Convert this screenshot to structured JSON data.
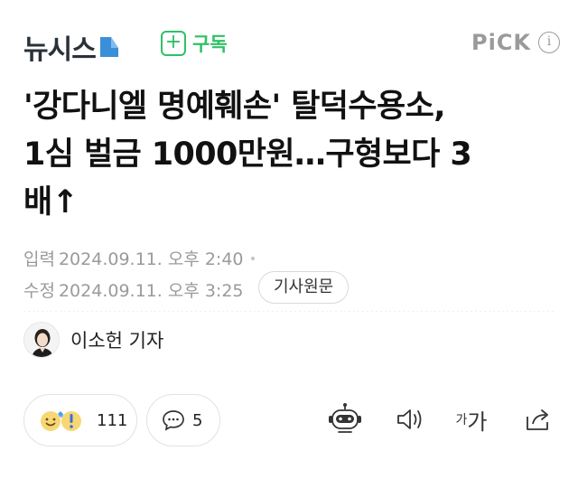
{
  "header": {
    "logo_text": "뉴시스",
    "subscribe_label": "구독",
    "pick_label": "PiCK",
    "info_glyph": "i"
  },
  "article": {
    "headline_lines": [
      "'강다니엘 명예훼손' 탈덕수용소,",
      "1심 벌금 1000만원…구형보다 3",
      "배↑"
    ],
    "published_label": "입력",
    "published_time": "2024.09.11. 오후 2:40",
    "modified_label": "수정",
    "modified_time": "2024.09.11. 오후 3:25",
    "original_button": "기사원문",
    "reporter_name": "이소헌 기자"
  },
  "actions": {
    "reaction_count": "111",
    "comment_count": "5",
    "icons": [
      "reaction-emoji-icon",
      "comment-icon",
      "robot-summary-icon",
      "speaker-icon",
      "font-size-icon",
      "share-icon"
    ],
    "font_size_small": "가",
    "font_size_large": "가"
  },
  "colors": {
    "accent_green": "#2fc067",
    "logo_gray": "#2b3138",
    "logo_blue": "#3a8fd8",
    "meta_gray": "#9a9a9a"
  }
}
